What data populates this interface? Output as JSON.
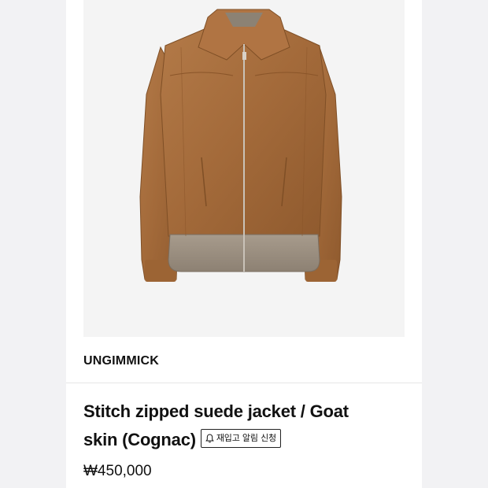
{
  "product": {
    "brand": "UNGIMMICK",
    "title": "Stitch zipped suede jacket / Goat skin (Cognac)",
    "title_line1": "Stitch zipped suede jacket / Goat",
    "title_line2": "skin (Cognac)",
    "restock_label": "재입고 알림 신청",
    "price": "₩450,000",
    "image_icon": "jacket-image",
    "color": "#a46a3c"
  }
}
